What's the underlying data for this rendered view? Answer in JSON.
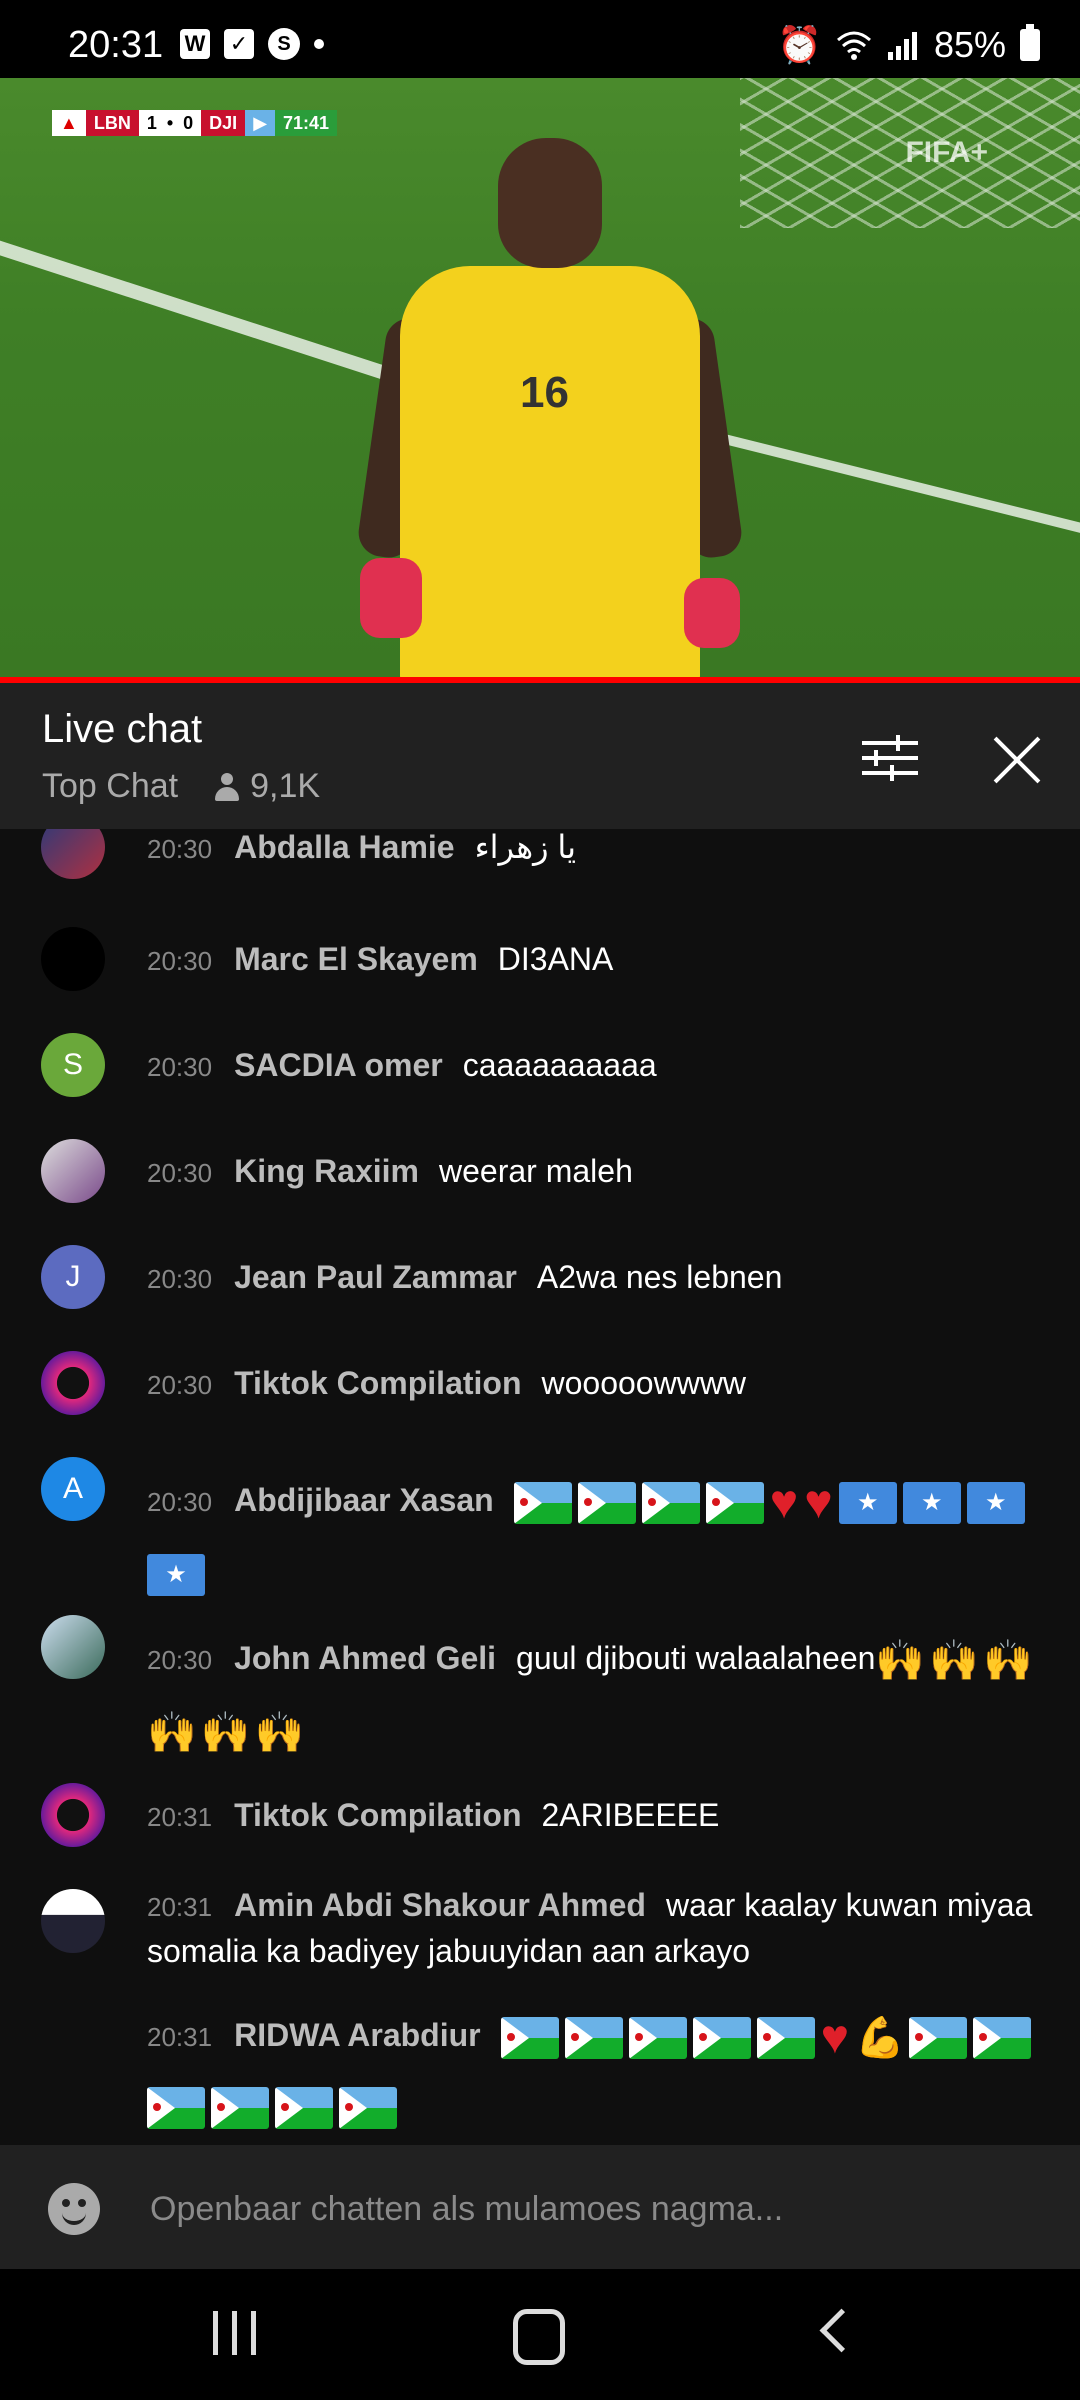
{
  "status_bar": {
    "time": "20:31",
    "battery": "85%",
    "icons": [
      "w-icon",
      "check-icon",
      "shazam-icon",
      "dot",
      "alarm-icon",
      "wifi-icon",
      "signal-icon",
      "battery-icon"
    ]
  },
  "video": {
    "scorebug": {
      "home": "LBN",
      "home_score": "1",
      "away_score": "0",
      "away": "DJI",
      "clock": "71:41"
    },
    "watermark": "FIFA+",
    "player_number": "16",
    "progress_fraction": 1.0
  },
  "chat_header": {
    "title": "Live chat",
    "mode": "Top Chat",
    "viewers": "9,1K"
  },
  "messages": [
    {
      "time": "20:30",
      "author": "Abdalla Hamie",
      "text": "يا زهراء",
      "avatar": ""
    },
    {
      "time": "20:30",
      "author": "Marc El Skayem",
      "text": "DI3ANA",
      "avatar": ""
    },
    {
      "time": "20:30",
      "author": "SACDIA omer",
      "text": "caaaaaaaaaa",
      "avatar": "S"
    },
    {
      "time": "20:30",
      "author": "King Raxiim",
      "text": "weerar maleh",
      "avatar": ""
    },
    {
      "time": "20:30",
      "author": "Jean Paul Zammar",
      "text": "A2wa nes lebnen",
      "avatar": "J"
    },
    {
      "time": "20:30",
      "author": "Tiktok Compilation",
      "text": "wooooowwww",
      "avatar": ""
    },
    {
      "time": "20:30",
      "author": "Abdijibaar Xasan",
      "text": "",
      "avatar": "A"
    },
    {
      "time": "20:30",
      "author": "John Ahmed Geli",
      "text": "guul djibouti walaalaheen",
      "avatar": ""
    },
    {
      "time": "20:31",
      "author": "Tiktok Compilation",
      "text": "2ARIBEEEE",
      "avatar": ""
    },
    {
      "time": "20:31",
      "author": "Amin Abdi Shakour Ahmed",
      "text": "waar kaalay kuwan miyaa somalia ka badiyey jabuuyidan aan arkayo",
      "avatar": ""
    },
    {
      "time": "20:31",
      "author": "RIDWA Arabdiur",
      "text": "",
      "avatar": ""
    }
  ],
  "input": {
    "placeholder": "Openbaar chatten als mulamoes nagma..."
  },
  "colors": {
    "accent": "#ff0000",
    "panel": "#212121",
    "background": "#0f0f0f",
    "muted": "#aaaaaa"
  }
}
